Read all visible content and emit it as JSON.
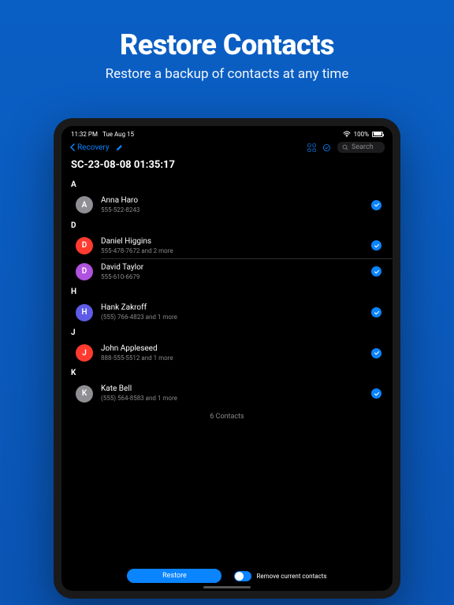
{
  "hero": {
    "title": "Restore Contacts",
    "subtitle": "Restore a backup of contacts at any time"
  },
  "statusbar": {
    "time": "11:32 PM",
    "date": "Tue Aug 15",
    "battery": "100%"
  },
  "navbar": {
    "back": "Recovery",
    "search_placeholder": "Search"
  },
  "page_title": "SC-23-08-08 01:35:17",
  "sections": {
    "a": {
      "header": "A"
    },
    "d": {
      "header": "D"
    },
    "h": {
      "header": "H"
    },
    "j": {
      "header": "J"
    },
    "k": {
      "header": "K"
    }
  },
  "contacts": {
    "anna": {
      "name": "Anna Haro",
      "detail": "555-522-8243",
      "initial": "A",
      "color": "#8e8e93"
    },
    "daniel": {
      "name": "Daniel Higgins",
      "detail": "555-478-7672 and 2 more",
      "initial": "D",
      "color": "#ff3b30"
    },
    "david": {
      "name": "David Taylor",
      "detail": "555-610-6679",
      "initial": "D",
      "color": "#af52de"
    },
    "hank": {
      "name": "Hank Zakroff",
      "detail": "(555) 766-4823 and 1 more",
      "initial": "H",
      "color": "#5e5ce6"
    },
    "john": {
      "name": "John Appleseed",
      "detail": "888-555-5512 and 1 more",
      "initial": "J",
      "color": "#ff3b30"
    },
    "kate": {
      "name": "Kate Bell",
      "detail": "(555) 564-8583 and 1 more",
      "initial": "K",
      "color": "#8e8e93"
    }
  },
  "count_label": "6 Contacts",
  "bottom": {
    "restore": "Restore",
    "remove_label": "Remove current contacts"
  }
}
